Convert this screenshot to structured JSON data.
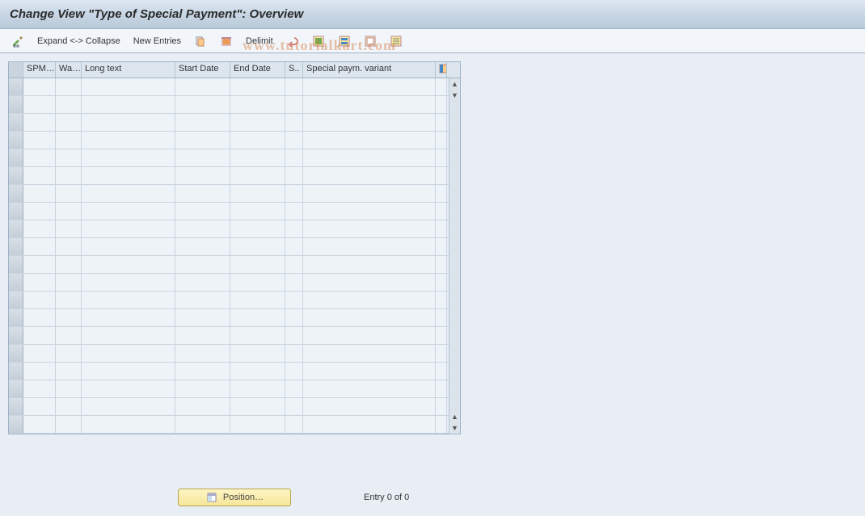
{
  "title": "Change View \"Type of Special Payment\": Overview",
  "toolbar": {
    "expand_collapse": "Expand <-> Collapse",
    "new_entries": "New Entries",
    "delimit": "Delimit"
  },
  "columns": {
    "spm": "SPM…",
    "wa": "Wa…",
    "long_text": "Long text",
    "start_date": "Start Date",
    "end_date": "End Date",
    "s": "S..",
    "spv": "Special paym. variant"
  },
  "rows_count": 20,
  "footer": {
    "position_label": "Position…",
    "entry_text": "Entry 0 of 0"
  },
  "watermark": "www.tutorialkart.com"
}
